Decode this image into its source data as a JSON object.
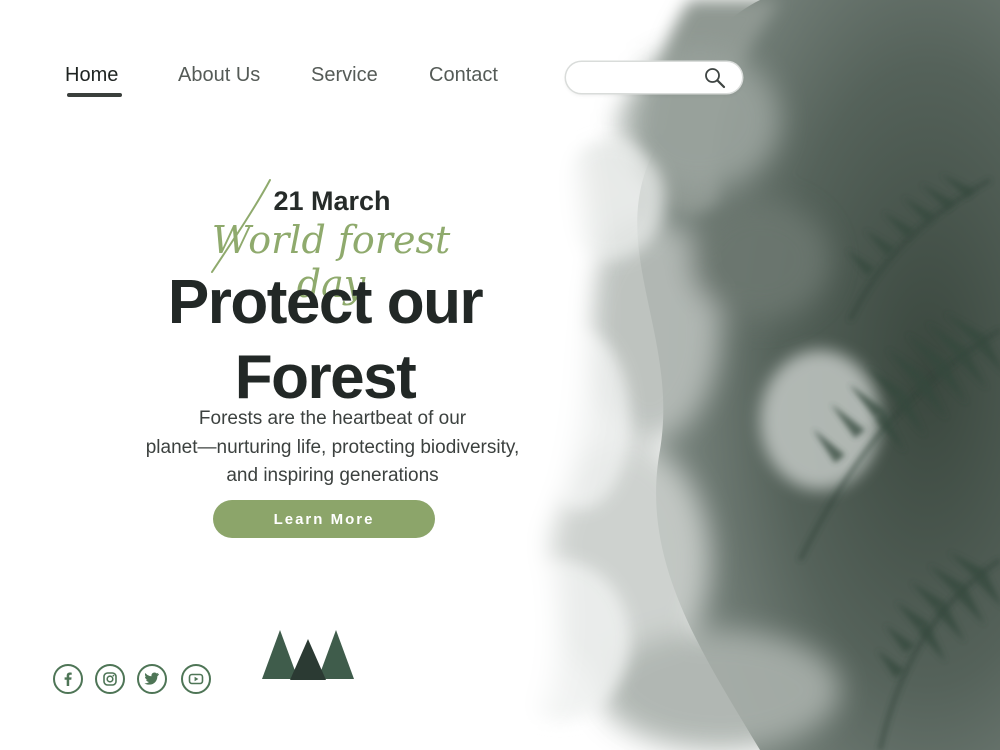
{
  "nav": {
    "items": [
      {
        "label": "Home",
        "active": true
      },
      {
        "label": "About Us",
        "active": false
      },
      {
        "label": "Service",
        "active": false
      },
      {
        "label": "Contact",
        "active": false
      }
    ]
  },
  "search": {
    "placeholder": "",
    "icon": "search-icon"
  },
  "hero": {
    "date": "21 March",
    "script_title": "World forest day",
    "headline_line1": "Protect our",
    "headline_line2": "Forest",
    "body_lines": [
      "Forests are the heartbeat of our",
      "planet—nurturing life, protecting biodiversity,",
      "and inspiring generations"
    ],
    "cta_label": "Learn More"
  },
  "footer": {
    "social_icons": [
      "facebook-icon",
      "instagram-icon",
      "twitter-icon",
      "youtube-icon"
    ],
    "logo_icon": "pine-trees-icon"
  },
  "colors": {
    "accent_green": "#8ca56a",
    "script_green": "#8faa6d",
    "icon_green": "#4e7556",
    "dark_text": "#222826",
    "fern_dark": "#2b3b33"
  }
}
